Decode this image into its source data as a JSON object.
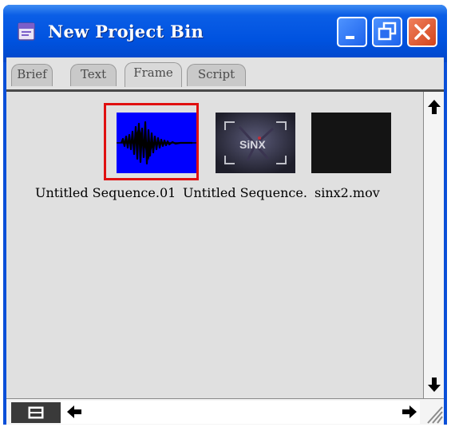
{
  "window": {
    "title": "New Project Bin"
  },
  "tabs": [
    {
      "label": "Brief",
      "active": false
    },
    {
      "label": "Text",
      "active": false
    },
    {
      "label": "Frame",
      "active": true
    },
    {
      "label": "Script",
      "active": false
    }
  ],
  "clips": [
    {
      "name": "Untitled Sequence.01",
      "thumbnail": "audio-waveform",
      "selected": true
    },
    {
      "name": "Untitled Sequence.",
      "thumbnail": "sinx-logo-frame",
      "selected": false,
      "thumbnail_text": "SiNX"
    },
    {
      "name": "sinx2.mov",
      "thumbnail": "black-frame",
      "selected": false
    }
  ],
  "icons": {
    "app": "project-bin-icon",
    "minimize": "minimize-icon",
    "maximize": "restore-icon",
    "close": "close-icon",
    "scroll_up": "arrow-up-icon",
    "scroll_down": "arrow-down-icon",
    "scroll_left": "arrow-left-icon",
    "scroll_right": "arrow-right-icon",
    "view_menu": "bin-menu-icon"
  },
  "colors": {
    "titlebar": "#0053e0",
    "close_button": "#d2441d",
    "selection": "#e01010",
    "waveform_bg": "#0000ff",
    "content_bg": "#e0e0e0"
  }
}
